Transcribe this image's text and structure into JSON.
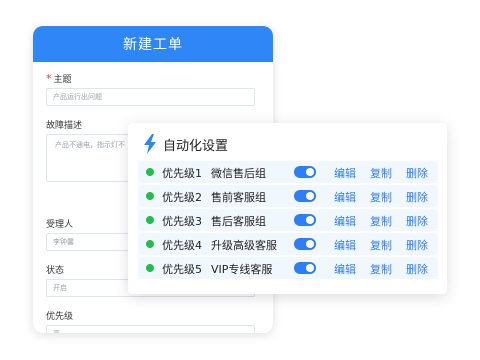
{
  "form": {
    "title": "新建工单",
    "subject": {
      "required_mark": "*",
      "label": "主题",
      "placeholder": "产品运行出问题"
    },
    "description": {
      "label": "故障描述",
      "value": "产品不通电，指示灯不"
    },
    "assignee": {
      "label": "受理人",
      "value": "李钟馨"
    },
    "status": {
      "label": "状态",
      "value": "开启"
    },
    "priority": {
      "label": "优先级",
      "value": "高"
    }
  },
  "automation": {
    "icon": "lightning-bolt-icon",
    "title": "自动化设置",
    "rules": [
      {
        "priority": "优先级1",
        "name": "微信售后组",
        "enabled": true,
        "edit": "编辑",
        "copy": "复制",
        "delete": "删除"
      },
      {
        "priority": "优先级2",
        "name": "售前客服组",
        "enabled": true,
        "edit": "编辑",
        "copy": "复制",
        "delete": "删除"
      },
      {
        "priority": "优先级3",
        "name": "售后客服组",
        "enabled": true,
        "edit": "编辑",
        "copy": "复制",
        "delete": "删除"
      },
      {
        "priority": "优先级4",
        "name": "升级高级客服",
        "enabled": true,
        "edit": "编辑",
        "copy": "复制",
        "delete": "删除"
      },
      {
        "priority": "优先级5",
        "name": "VIP专线客服",
        "enabled": true,
        "edit": "编辑",
        "copy": "复制",
        "delete": "删除"
      }
    ]
  },
  "colors": {
    "header_blue": "#2f86f6",
    "link_blue": "#2f7ef5",
    "status_green": "#22bd49",
    "row_background": "#f1f7fe",
    "required_red": "#e53935"
  }
}
